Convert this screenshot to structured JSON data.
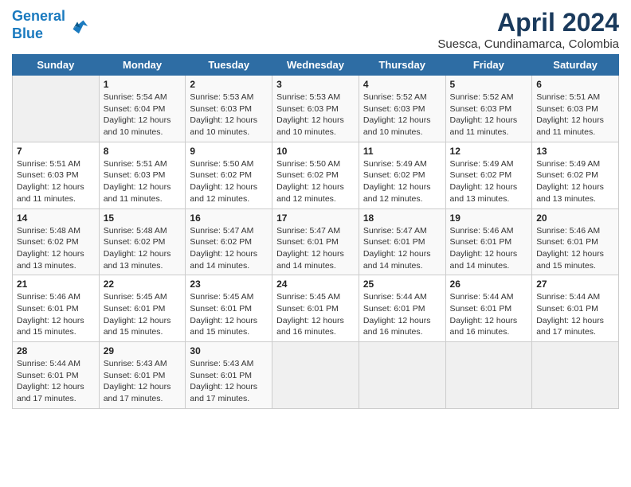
{
  "header": {
    "logo_line1": "General",
    "logo_line2": "Blue",
    "title": "April 2024",
    "subtitle": "Suesca, Cundinamarca, Colombia"
  },
  "calendar": {
    "days_of_week": [
      "Sunday",
      "Monday",
      "Tuesday",
      "Wednesday",
      "Thursday",
      "Friday",
      "Saturday"
    ],
    "weeks": [
      [
        {
          "day": "",
          "info": ""
        },
        {
          "day": "1",
          "info": "Sunrise: 5:54 AM\nSunset: 6:04 PM\nDaylight: 12 hours\nand 10 minutes."
        },
        {
          "day": "2",
          "info": "Sunrise: 5:53 AM\nSunset: 6:03 PM\nDaylight: 12 hours\nand 10 minutes."
        },
        {
          "day": "3",
          "info": "Sunrise: 5:53 AM\nSunset: 6:03 PM\nDaylight: 12 hours\nand 10 minutes."
        },
        {
          "day": "4",
          "info": "Sunrise: 5:52 AM\nSunset: 6:03 PM\nDaylight: 12 hours\nand 10 minutes."
        },
        {
          "day": "5",
          "info": "Sunrise: 5:52 AM\nSunset: 6:03 PM\nDaylight: 12 hours\nand 11 minutes."
        },
        {
          "day": "6",
          "info": "Sunrise: 5:51 AM\nSunset: 6:03 PM\nDaylight: 12 hours\nand 11 minutes."
        }
      ],
      [
        {
          "day": "7",
          "info": "Sunrise: 5:51 AM\nSunset: 6:03 PM\nDaylight: 12 hours\nand 11 minutes."
        },
        {
          "day": "8",
          "info": "Sunrise: 5:51 AM\nSunset: 6:03 PM\nDaylight: 12 hours\nand 11 minutes."
        },
        {
          "day": "9",
          "info": "Sunrise: 5:50 AM\nSunset: 6:02 PM\nDaylight: 12 hours\nand 12 minutes."
        },
        {
          "day": "10",
          "info": "Sunrise: 5:50 AM\nSunset: 6:02 PM\nDaylight: 12 hours\nand 12 minutes."
        },
        {
          "day": "11",
          "info": "Sunrise: 5:49 AM\nSunset: 6:02 PM\nDaylight: 12 hours\nand 12 minutes."
        },
        {
          "day": "12",
          "info": "Sunrise: 5:49 AM\nSunset: 6:02 PM\nDaylight: 12 hours\nand 13 minutes."
        },
        {
          "day": "13",
          "info": "Sunrise: 5:49 AM\nSunset: 6:02 PM\nDaylight: 12 hours\nand 13 minutes."
        }
      ],
      [
        {
          "day": "14",
          "info": "Sunrise: 5:48 AM\nSunset: 6:02 PM\nDaylight: 12 hours\nand 13 minutes."
        },
        {
          "day": "15",
          "info": "Sunrise: 5:48 AM\nSunset: 6:02 PM\nDaylight: 12 hours\nand 13 minutes."
        },
        {
          "day": "16",
          "info": "Sunrise: 5:47 AM\nSunset: 6:02 PM\nDaylight: 12 hours\nand 14 minutes."
        },
        {
          "day": "17",
          "info": "Sunrise: 5:47 AM\nSunset: 6:01 PM\nDaylight: 12 hours\nand 14 minutes."
        },
        {
          "day": "18",
          "info": "Sunrise: 5:47 AM\nSunset: 6:01 PM\nDaylight: 12 hours\nand 14 minutes."
        },
        {
          "day": "19",
          "info": "Sunrise: 5:46 AM\nSunset: 6:01 PM\nDaylight: 12 hours\nand 14 minutes."
        },
        {
          "day": "20",
          "info": "Sunrise: 5:46 AM\nSunset: 6:01 PM\nDaylight: 12 hours\nand 15 minutes."
        }
      ],
      [
        {
          "day": "21",
          "info": "Sunrise: 5:46 AM\nSunset: 6:01 PM\nDaylight: 12 hours\nand 15 minutes."
        },
        {
          "day": "22",
          "info": "Sunrise: 5:45 AM\nSunset: 6:01 PM\nDaylight: 12 hours\nand 15 minutes."
        },
        {
          "day": "23",
          "info": "Sunrise: 5:45 AM\nSunset: 6:01 PM\nDaylight: 12 hours\nand 15 minutes."
        },
        {
          "day": "24",
          "info": "Sunrise: 5:45 AM\nSunset: 6:01 PM\nDaylight: 12 hours\nand 16 minutes."
        },
        {
          "day": "25",
          "info": "Sunrise: 5:44 AM\nSunset: 6:01 PM\nDaylight: 12 hours\nand 16 minutes."
        },
        {
          "day": "26",
          "info": "Sunrise: 5:44 AM\nSunset: 6:01 PM\nDaylight: 12 hours\nand 16 minutes."
        },
        {
          "day": "27",
          "info": "Sunrise: 5:44 AM\nSunset: 6:01 PM\nDaylight: 12 hours\nand 17 minutes."
        }
      ],
      [
        {
          "day": "28",
          "info": "Sunrise: 5:44 AM\nSunset: 6:01 PM\nDaylight: 12 hours\nand 17 minutes."
        },
        {
          "day": "29",
          "info": "Sunrise: 5:43 AM\nSunset: 6:01 PM\nDaylight: 12 hours\nand 17 minutes."
        },
        {
          "day": "30",
          "info": "Sunrise: 5:43 AM\nSunset: 6:01 PM\nDaylight: 12 hours\nand 17 minutes."
        },
        {
          "day": "",
          "info": ""
        },
        {
          "day": "",
          "info": ""
        },
        {
          "day": "",
          "info": ""
        },
        {
          "day": "",
          "info": ""
        }
      ]
    ]
  }
}
